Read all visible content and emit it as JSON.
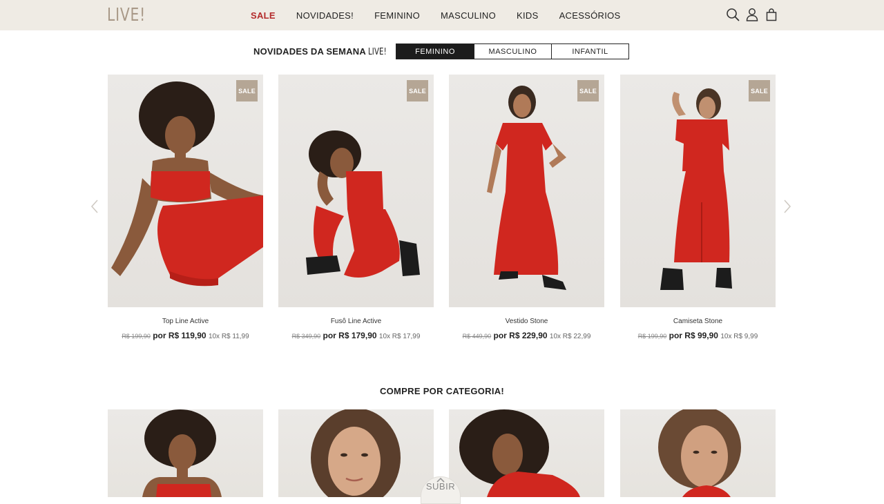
{
  "header": {
    "logo": "LIVE!",
    "nav": [
      "SALE",
      "NOVIDADES!",
      "FEMININO",
      "MASCULINO",
      "KIDS",
      "ACESSÓRIOS"
    ],
    "icons": [
      "search-icon",
      "user-icon",
      "bag-icon"
    ]
  },
  "week": {
    "title": "NOVIDADES DA SEMANA",
    "brand": "LIVE!",
    "tabs": [
      "FEMININO",
      "MASCULINO",
      "INFANTIL"
    ],
    "active_tab": "FEMININO"
  },
  "products": [
    {
      "badge": "SALE",
      "name": "Top Line Active",
      "old_price": "R$ 199,90",
      "price": "por R$ 119,90",
      "installments": "10x R$ 11,99"
    },
    {
      "badge": "SALE",
      "name": "Fusô Line Active",
      "old_price": "R$ 349,90",
      "price": "por R$ 179,90",
      "installments": "10x R$ 17,99"
    },
    {
      "badge": "SALE",
      "name": "Vestido Stone",
      "old_price": "R$ 449,90",
      "price": "por R$ 229,90",
      "installments": "10x R$ 22,99"
    },
    {
      "badge": "SALE",
      "name": "Camiseta Stone",
      "old_price": "R$ 199,90",
      "price": "por R$ 99,90",
      "installments": "10x R$ 9,99"
    }
  ],
  "categories": {
    "title": "COMPRE POR CATEGORIA!"
  },
  "scroll_top": {
    "label": "SUBIR"
  },
  "colors": {
    "header_bg": "#efebe4",
    "sale_red": "#b32a2a",
    "badge_bg": "#b5a695",
    "garment_red": "#d0271f"
  }
}
